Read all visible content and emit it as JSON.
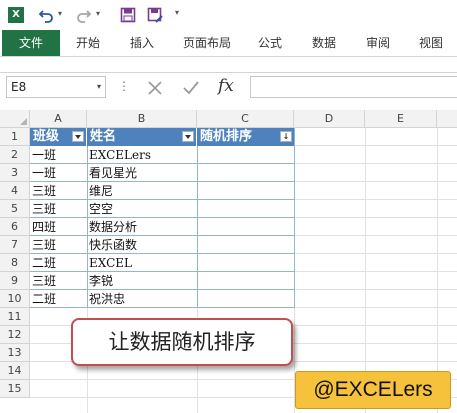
{
  "qat": {
    "excel_logo": "X",
    "icons": [
      "excel-icon",
      "undo-icon",
      "redo-icon",
      "save-icon",
      "save-as-icon",
      "customize-icon"
    ]
  },
  "tabs": [
    {
      "label": "文件"
    },
    {
      "label": "开始"
    },
    {
      "label": "插入"
    },
    {
      "label": "页面布局"
    },
    {
      "label": "公式"
    },
    {
      "label": "数据"
    },
    {
      "label": "审阅"
    },
    {
      "label": "视图"
    }
  ],
  "formula_bar": {
    "name_box": "E8",
    "fx": "fx",
    "value": ""
  },
  "columns": [
    "A",
    "B",
    "C",
    "D",
    "E"
  ],
  "rows": [
    "1",
    "2",
    "3",
    "4",
    "5",
    "6",
    "7",
    "8",
    "9",
    "10",
    "11",
    "12",
    "13",
    "14",
    "15"
  ],
  "table": {
    "headers": [
      "班级",
      "姓名",
      "随机排序"
    ],
    "data": [
      [
        "一班",
        "EXCELers"
      ],
      [
        "一班",
        "看见星光"
      ],
      [
        "三班",
        "维尼"
      ],
      [
        "三班",
        "空空"
      ],
      [
        "四班",
        "数据分析"
      ],
      [
        "三班",
        "快乐函数"
      ],
      [
        "二班",
        "EXCEL"
      ],
      [
        "三班",
        "李锐"
      ],
      [
        "二班",
        "祝洪忠"
      ]
    ],
    "header_color": "#4f81bd"
  },
  "callout": {
    "text": "让数据随机排序",
    "border_color": "#c0504d"
  },
  "watermark": {
    "text": "@EXCELers",
    "color": "#f6c23c"
  },
  "colors": {
    "file_tab": "#217346"
  }
}
